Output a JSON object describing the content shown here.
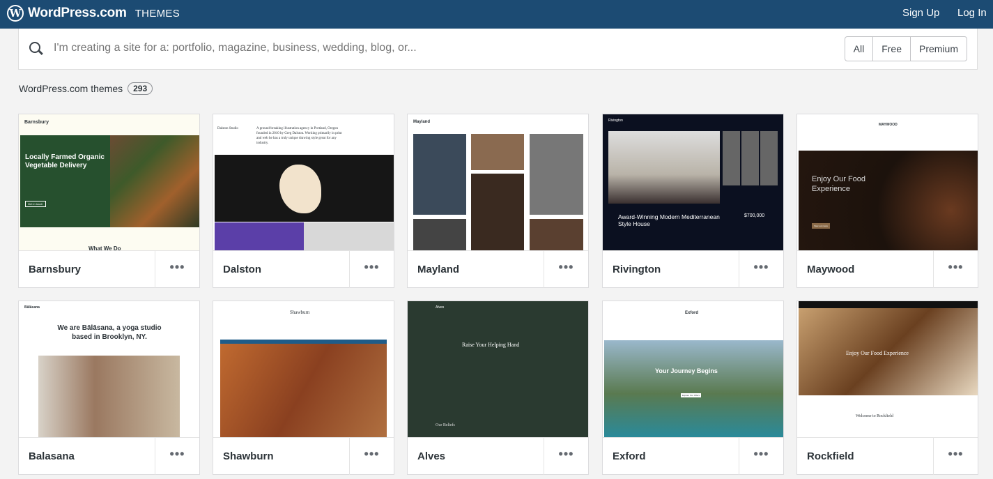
{
  "header": {
    "brand": "WordPress.com",
    "brand_sub": "THEMES",
    "sign_up": "Sign Up",
    "log_in": "Log In",
    "color": "#1c4b73"
  },
  "search": {
    "placeholder": "I'm creating a site for a: portfolio, magazine, business, wedding, blog, or...",
    "filters": [
      "All",
      "Free",
      "Premium"
    ]
  },
  "themes_label": "WordPress.com themes",
  "themes_count": "293",
  "more_label": "•••",
  "themes": [
    {
      "name": "Barnsbury",
      "preview": {
        "site": "Barnsbury",
        "headline": "Locally Farmed Organic Vegetable Delivery",
        "button": "Get in touch",
        "section": "What We Do"
      }
    },
    {
      "name": "Dalston",
      "preview": {
        "site": "Dalston Studio",
        "headline": "A ground-breaking illustration agency in Portland, Oregon founded in 2010 by Greg Dalston. Working primarily in print and web he has a truly unique drawing style great for any industry."
      }
    },
    {
      "name": "Mayland",
      "preview": {
        "site": "Mayland"
      }
    },
    {
      "name": "Rivington",
      "preview": {
        "site": "Rivington",
        "headline": "Award-Winning Modern Mediterranean Style House",
        "price": "$700,000"
      }
    },
    {
      "name": "Maywood",
      "preview": {
        "site": "MAYWOOD",
        "headline": "Enjoy Our Food Experience",
        "button": "View our menu"
      }
    },
    {
      "name": "Balasana",
      "preview": {
        "site": "Bālāsana",
        "headline": "We are Bālāsana, a yoga studio based in Brooklyn, NY."
      }
    },
    {
      "name": "Shawburn",
      "preview": {
        "site": "Shawburn"
      }
    },
    {
      "name": "Alves",
      "preview": {
        "site": "Alves",
        "headline": "Raise Your Helping Hand",
        "section": "Our Beliefs"
      }
    },
    {
      "name": "Exford",
      "preview": {
        "site": "Exford",
        "headline": "Your Journey Begins",
        "button": "Explore Our Offers"
      }
    },
    {
      "name": "Rockfield",
      "preview": {
        "headline": "Enjoy Our Food Experience",
        "section": "Welcome to Rockfield"
      }
    }
  ]
}
